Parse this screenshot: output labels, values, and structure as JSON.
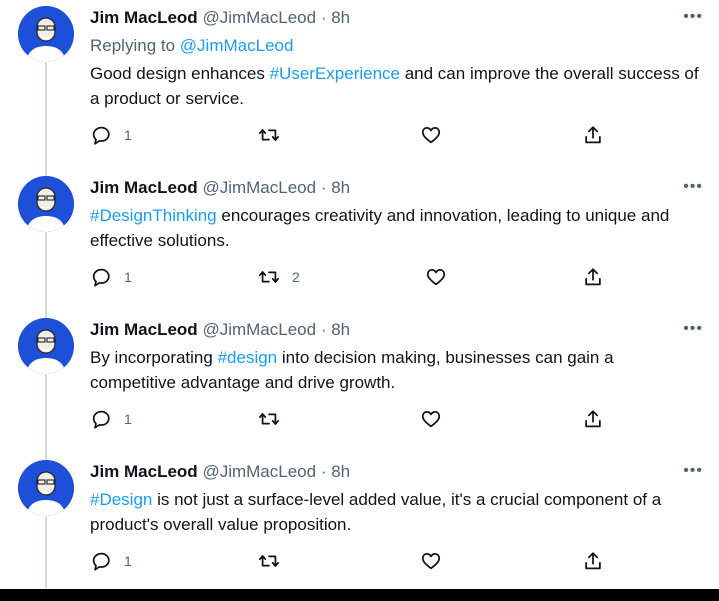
{
  "author": {
    "name": "Jim MacLeod",
    "handle": "@JimMacLeod",
    "separator": "·"
  },
  "replying": {
    "prefix": "Replying to",
    "mention": "@JimMacLeod"
  },
  "icons": {
    "reply": "reply-icon",
    "retweet": "retweet-icon",
    "like": "heart-icon",
    "share": "share-icon",
    "more": "more-options-icon"
  },
  "colors": {
    "link": "#1d9bf0",
    "muted": "#536471",
    "thread": "#cfd9de"
  },
  "more_label": "•••",
  "tweets": [
    {
      "time": "8h",
      "text_before": "Good design enhances ",
      "hashtag": "#UserExperience",
      "text_after": " and can improve the overall success of a product or service.",
      "replies": "1",
      "retweets": "",
      "likes": ""
    },
    {
      "time": "8h",
      "text_before": "",
      "hashtag": "#DesignThinking",
      "text_after": " encourages creativity and innovation, leading to unique and effective solutions.",
      "replies": "1",
      "retweets": "2",
      "likes": ""
    },
    {
      "time": "8h",
      "text_before": "By incorporating ",
      "hashtag": "#design",
      "text_after": " into decision making, businesses can gain a competitive advantage and drive growth.",
      "replies": "1",
      "retweets": "",
      "likes": ""
    },
    {
      "time": "8h",
      "text_before": "",
      "hashtag": "#Design",
      "text_after": " is not just a surface-level added value, it's a crucial component of a product's overall value proposition.",
      "replies": "1",
      "retweets": "",
      "likes": ""
    }
  ]
}
